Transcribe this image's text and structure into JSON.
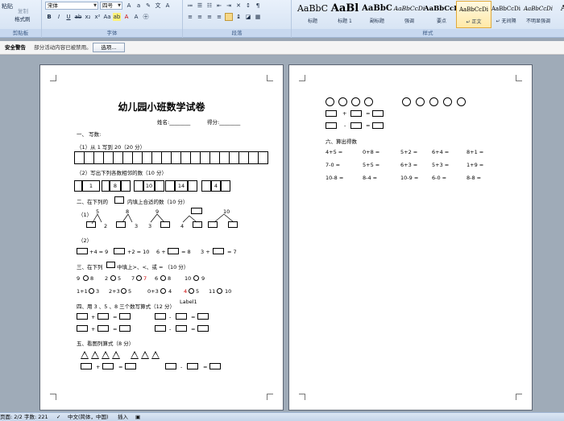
{
  "ribbon": {
    "clipboard": {
      "paste": "粘贴",
      "copy": "复制",
      "format_painter": "格式刷",
      "label": "剪贴板"
    },
    "font": {
      "name": "宋体",
      "size": "四号",
      "label": "字体"
    },
    "paragraph": {
      "label": "段落"
    },
    "styles": {
      "label": "样式",
      "items": [
        {
          "sample": "AaBbC",
          "label": "标题"
        },
        {
          "sample": "AaBl",
          "label": "标题 1"
        },
        {
          "sample": "AaBbC",
          "label": "副标题"
        },
        {
          "sample": "AaBbCcDi",
          "label": "强调"
        },
        {
          "sample": "AaBbCcD",
          "label": "要点"
        },
        {
          "sample": "AaBbCcDi",
          "label": "↵ 正文"
        },
        {
          "sample": "AaBbCcDi",
          "label": "↵ 无间隔"
        },
        {
          "sample": "AaBbCcDi",
          "label": "不明显强调"
        },
        {
          "sample": "AaBb",
          "label": "明显"
        }
      ]
    }
  },
  "security_bar": {
    "title": "安全警告",
    "message": "部分活动内容已被禁用。",
    "options_button": "选项..."
  },
  "page1": {
    "title": "幼儿园小班数学试卷",
    "name_line": "姓名:________",
    "score_line": "得分:________",
    "q1": "一、  写数:",
    "q1_1": "（1）从 1 写到 20（20 分）",
    "q1_2": "（2）写出下列各数相邻的数（10 分）",
    "seq": [
      "1",
      "8",
      "10",
      "14",
      "4"
    ],
    "q2": "二、在下列的",
    "q2_tail": "内填上合适的数（10 分）",
    "q2_1": "（1）",
    "tree_tops": [
      "5",
      "8",
      "9",
      "10"
    ],
    "tree_leaves": [
      "2",
      "3",
      "3",
      "4"
    ],
    "q2_2": "（2）",
    "eq_row": [
      "+4 = 9",
      "+2 = 10",
      "6 +",
      "= 8",
      "3 +",
      "= 7"
    ],
    "q3": "三、在下列",
    "q3_tail": "中填上>、<、或 =  （10 分）",
    "cmp_row1": [
      "9",
      "8",
      "2",
      "5",
      "7",
      "7",
      "6",
      "8",
      "10",
      "9"
    ],
    "cmp_row2": [
      "1+1",
      "3",
      "2+3",
      "5",
      "0+3",
      "4",
      "4",
      "5",
      "11",
      "10"
    ],
    "q4": "四、用 3 、5 、8  三个数写算式（12 分）",
    "q4_label": "Label1",
    "q5": "五、看图列算式（8 分）",
    "ops": [
      "+",
      "=",
      "-",
      "=",
      "+",
      "=",
      "-",
      "=",
      "+",
      "=",
      "-",
      "="
    ]
  },
  "page2": {
    "ops_top": [
      "+",
      "=",
      "-",
      "="
    ],
    "q6": "六、算出得数",
    "calc_rows": [
      [
        "4+5 =",
        "0+8 =",
        "5+2 =",
        "6+4 =",
        "8+1 ="
      ],
      [
        "7-0 =",
        "5+5 =",
        "6+3 =",
        "5+3 =",
        "1+9 ="
      ],
      [
        "10-8 =",
        "8-4 =",
        "10-9 =",
        "6-0 =",
        "8-8 ="
      ]
    ]
  },
  "status": {
    "page": "页面: 2/2",
    "words": "字数: 221",
    "lang": "中文(简体，中国)",
    "mode": "插入"
  }
}
